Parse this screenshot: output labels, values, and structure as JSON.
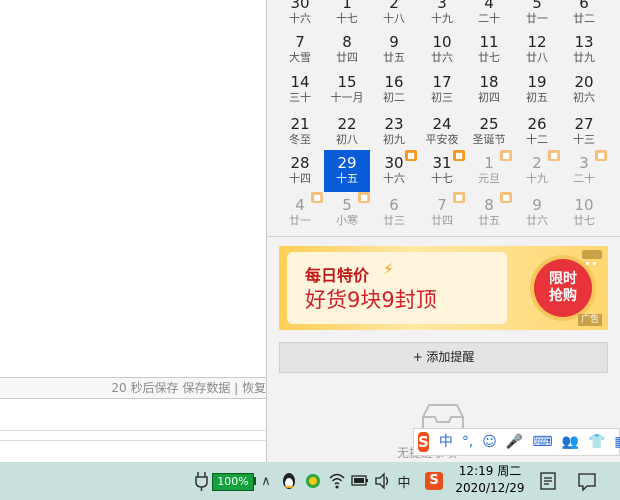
{
  "status_bar": {
    "text": "20 秒后保存 保存数据 | 恢复"
  },
  "calendar": {
    "weeks": [
      [
        {
          "day": "30",
          "lunar": "十六",
          "other": false,
          "today": false,
          "holiday": false
        },
        {
          "day": "1",
          "lunar": "十七",
          "other": false,
          "today": false,
          "holiday": false
        },
        {
          "day": "2",
          "lunar": "十八",
          "other": false,
          "today": false,
          "holiday": false
        },
        {
          "day": "3",
          "lunar": "十九",
          "other": false,
          "today": false,
          "holiday": false
        },
        {
          "day": "4",
          "lunar": "二十",
          "other": false,
          "today": false,
          "holiday": false
        },
        {
          "day": "5",
          "lunar": "廿一",
          "other": false,
          "today": false,
          "holiday": false
        },
        {
          "day": "6",
          "lunar": "廿二",
          "other": false,
          "today": false,
          "holiday": false
        }
      ],
      [
        {
          "day": "7",
          "lunar": "大雪",
          "other": false,
          "today": false,
          "holiday": false
        },
        {
          "day": "8",
          "lunar": "廿四",
          "other": false,
          "today": false,
          "holiday": false
        },
        {
          "day": "9",
          "lunar": "廿五",
          "other": false,
          "today": false,
          "holiday": false
        },
        {
          "day": "10",
          "lunar": "廿六",
          "other": false,
          "today": false,
          "holiday": false
        },
        {
          "day": "11",
          "lunar": "廿七",
          "other": false,
          "today": false,
          "holiday": false
        },
        {
          "day": "12",
          "lunar": "廿八",
          "other": false,
          "today": false,
          "holiday": false
        },
        {
          "day": "13",
          "lunar": "廿九",
          "other": false,
          "today": false,
          "holiday": false
        }
      ],
      [
        {
          "day": "14",
          "lunar": "三十",
          "other": false,
          "today": false,
          "holiday": false
        },
        {
          "day": "15",
          "lunar": "十一月",
          "other": false,
          "today": false,
          "holiday": false
        },
        {
          "day": "16",
          "lunar": "初二",
          "other": false,
          "today": false,
          "holiday": false
        },
        {
          "day": "17",
          "lunar": "初三",
          "other": false,
          "today": false,
          "holiday": false
        },
        {
          "day": "18",
          "lunar": "初四",
          "other": false,
          "today": false,
          "holiday": false
        },
        {
          "day": "19",
          "lunar": "初五",
          "other": false,
          "today": false,
          "holiday": false
        },
        {
          "day": "20",
          "lunar": "初六",
          "other": false,
          "today": false,
          "holiday": false
        }
      ],
      [
        {
          "day": "21",
          "lunar": "冬至",
          "other": false,
          "today": false,
          "holiday": false
        },
        {
          "day": "22",
          "lunar": "初八",
          "other": false,
          "today": false,
          "holiday": false
        },
        {
          "day": "23",
          "lunar": "初九",
          "other": false,
          "today": false,
          "holiday": false
        },
        {
          "day": "24",
          "lunar": "平安夜",
          "other": false,
          "today": false,
          "holiday": false
        },
        {
          "day": "25",
          "lunar": "圣诞节",
          "other": false,
          "today": false,
          "holiday": false
        },
        {
          "day": "26",
          "lunar": "十二",
          "other": false,
          "today": false,
          "holiday": false
        },
        {
          "day": "27",
          "lunar": "十三",
          "other": false,
          "today": false,
          "holiday": false
        }
      ],
      [
        {
          "day": "28",
          "lunar": "十四",
          "other": false,
          "today": false,
          "holiday": false
        },
        {
          "day": "29",
          "lunar": "十五",
          "other": false,
          "today": true,
          "holiday": false
        },
        {
          "day": "30",
          "lunar": "十六",
          "other": false,
          "today": false,
          "holiday": true
        },
        {
          "day": "31",
          "lunar": "十七",
          "other": false,
          "today": false,
          "holiday": true
        },
        {
          "day": "1",
          "lunar": "元旦",
          "other": true,
          "today": false,
          "holiday": true
        },
        {
          "day": "2",
          "lunar": "十九",
          "other": true,
          "today": false,
          "holiday": true
        },
        {
          "day": "3",
          "lunar": "二十",
          "other": true,
          "today": false,
          "holiday": true
        }
      ],
      [
        {
          "day": "4",
          "lunar": "廿一",
          "other": true,
          "today": false,
          "holiday": true
        },
        {
          "day": "5",
          "lunar": "小寒",
          "other": true,
          "today": false,
          "holiday": true
        },
        {
          "day": "6",
          "lunar": "廿三",
          "other": true,
          "today": false,
          "holiday": false
        },
        {
          "day": "7",
          "lunar": "廿四",
          "other": true,
          "today": false,
          "holiday": true
        },
        {
          "day": "8",
          "lunar": "廿五",
          "other": true,
          "today": false,
          "holiday": true
        },
        {
          "day": "9",
          "lunar": "廿六",
          "other": true,
          "today": false,
          "holiday": false
        },
        {
          "day": "10",
          "lunar": "廿七",
          "other": true,
          "today": false,
          "holiday": false
        }
      ]
    ],
    "holiday_icon": "bus-icon"
  },
  "ad": {
    "line1": "每日特价",
    "line2": "好货9块9封顶",
    "badge_line1": "限时",
    "badge_line2": "抢购",
    "tag": "广告"
  },
  "add_reminder": {
    "label": "+ 添加提醒"
  },
  "empty_state": {
    "icon": "inbox-icon",
    "text": "无提醒事项"
  },
  "ime": {
    "logo": "S",
    "mode": "中",
    "items": [
      "°,",
      "☺",
      "🎤",
      "⌨",
      "👥",
      "👕",
      "▦"
    ]
  },
  "taskbar": {
    "battery": "100%",
    "input_lang": "中",
    "time": "12:19 周二",
    "date": "2020/12/29",
    "colors": {
      "background": "#c8e1dc",
      "battery": "#14a03c"
    }
  }
}
